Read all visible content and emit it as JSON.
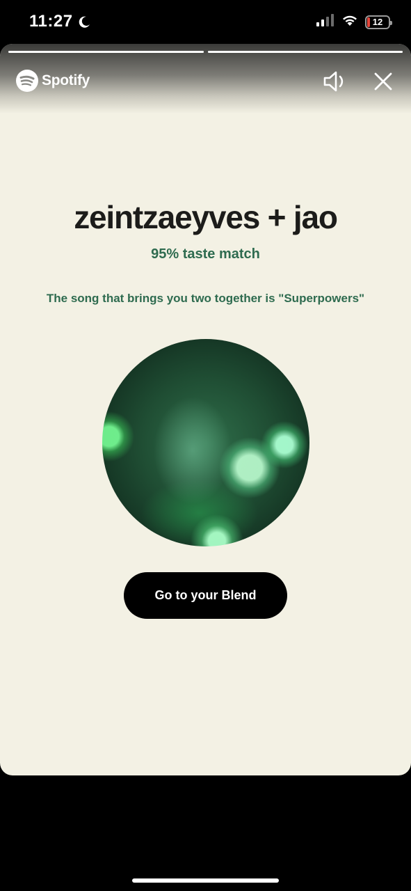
{
  "status_bar": {
    "time": "11:27",
    "battery_level": "12",
    "battery_fraction": 0.12
  },
  "story": {
    "progress_segments": [
      {
        "fill_fraction": 1.0
      },
      {
        "fill_fraction": 1.0
      }
    ],
    "brand": "Spotify",
    "title": "zeintzaeyves + jao",
    "taste_match": "95% taste match",
    "song_line": "The song that brings you two together is \"Superpowers\"",
    "button_label": "Go to your Blend"
  },
  "colors": {
    "card_background": "#f3f1e4",
    "accent_green": "#2e6b4f",
    "button_background": "#000000"
  }
}
